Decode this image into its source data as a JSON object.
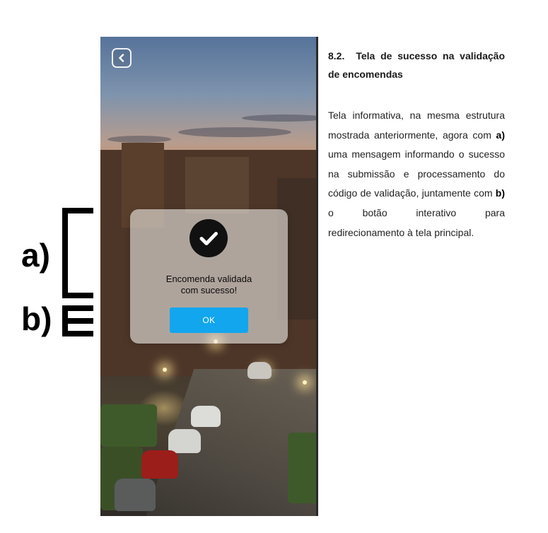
{
  "annotations": [
    {
      "label": "a)"
    },
    {
      "label": "b)"
    }
  ],
  "phone": {
    "back_icon": "chevron-left-icon",
    "modal": {
      "icon": "check-circle-icon",
      "message": "Encomenda validada\ncom sucesso!",
      "ok_label": "OK"
    },
    "colors": {
      "button": "#12a6ee",
      "check_bg": "#111111"
    }
  },
  "document": {
    "section_number": "8.2.",
    "section_title": "Tela de sucesso na validação de encomendas",
    "para_intro": "Tela informativa, na mesma estrutura mostrada anteriormente, agora com ",
    "marker_a": "a)",
    "para_mid": " uma mensagem informando o sucesso na submissão e processamento do código de validação, juntamente com ",
    "marker_b": "b)",
    "para_end": " o botão interativo para redirecionamento à tela principal."
  }
}
